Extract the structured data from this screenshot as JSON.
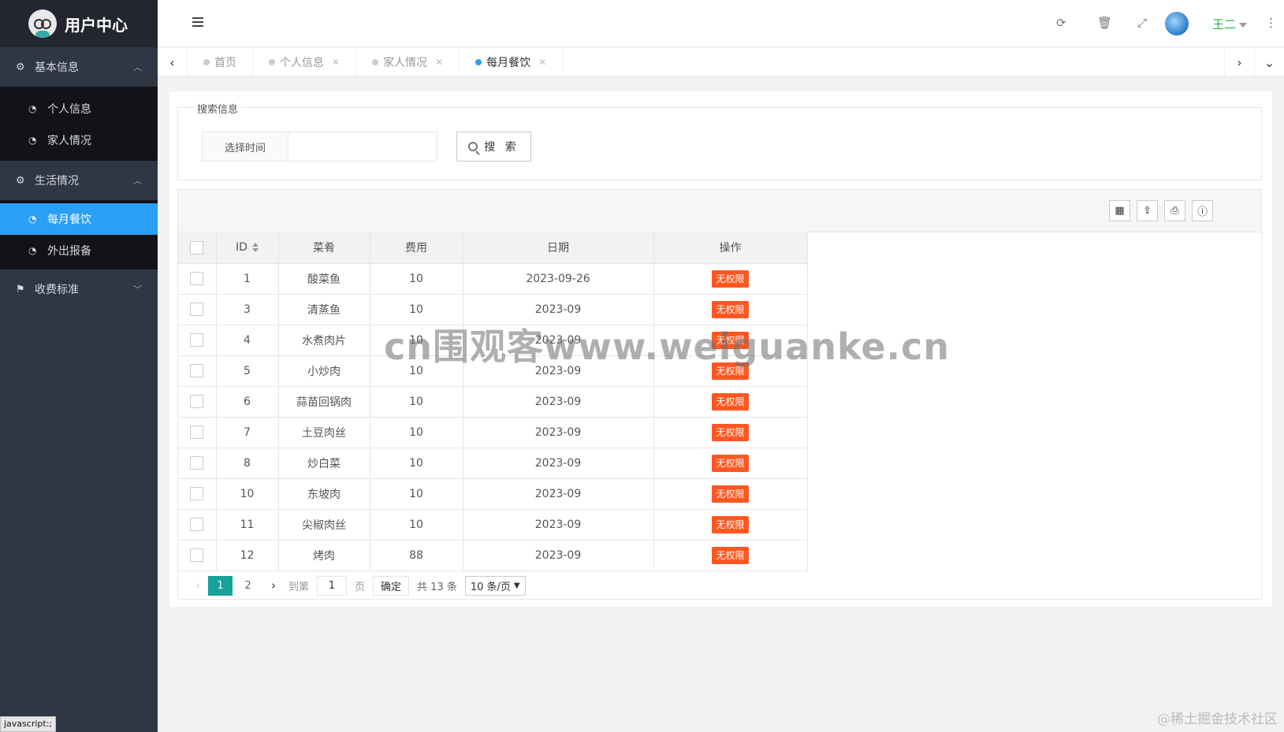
{
  "app": {
    "title": "用户中心"
  },
  "sidebar": {
    "groups": [
      {
        "label": "基本信息",
        "items": [
          {
            "label": "个人信息"
          },
          {
            "label": "家人情况"
          }
        ]
      },
      {
        "label": "生活情况",
        "items": [
          {
            "label": "每月餐饮"
          },
          {
            "label": "外出报备"
          }
        ]
      },
      {
        "label": "收费标准"
      }
    ],
    "active_item": "每月餐饮"
  },
  "header": {
    "user_name": "王二"
  },
  "tabs": [
    {
      "label": "首页",
      "closable": false
    },
    {
      "label": "个人信息",
      "closable": true
    },
    {
      "label": "家人情况",
      "closable": true
    },
    {
      "label": "每月餐饮",
      "closable": true,
      "active": true
    }
  ],
  "search": {
    "legend": "搜索信息",
    "time_label": "选择时间",
    "time_value": "",
    "button_label": "搜 索"
  },
  "table": {
    "columns": [
      "ID",
      "菜肴",
      "费用",
      "日期",
      "操作"
    ],
    "rows": [
      {
        "id": "1",
        "dish": "酸菜鱼",
        "cost": "10",
        "date": "2023-09-26",
        "action": "无权限"
      },
      {
        "id": "3",
        "dish": "清蒸鱼",
        "cost": "10",
        "date": "2023-09",
        "action": "无权限"
      },
      {
        "id": "4",
        "dish": "水煮肉片",
        "cost": "10",
        "date": "2023-09",
        "action": "无权限"
      },
      {
        "id": "5",
        "dish": "小炒肉",
        "cost": "10",
        "date": "2023-09",
        "action": "无权限"
      },
      {
        "id": "6",
        "dish": "蒜苗回锅肉",
        "cost": "10",
        "date": "2023-09",
        "action": "无权限"
      },
      {
        "id": "7",
        "dish": "土豆肉丝",
        "cost": "10",
        "date": "2023-09",
        "action": "无权限"
      },
      {
        "id": "8",
        "dish": "炒白菜",
        "cost": "10",
        "date": "2023-09",
        "action": "无权限"
      },
      {
        "id": "10",
        "dish": "东坡肉",
        "cost": "10",
        "date": "2023-09",
        "action": "无权限"
      },
      {
        "id": "11",
        "dish": "尖椒肉丝",
        "cost": "10",
        "date": "2023-09",
        "action": "无权限"
      },
      {
        "id": "12",
        "dish": "烤肉",
        "cost": "88",
        "date": "2023-09",
        "action": "无权限"
      }
    ]
  },
  "pager": {
    "pages": [
      "1",
      "2"
    ],
    "current": "1",
    "goto_label": "到第",
    "goto_value": "1",
    "page_unit": "页",
    "ok_label": "确定",
    "total": "共 13 条",
    "page_size": "10 条/页"
  },
  "status_tip": "javascript:;",
  "watermark": "cn围观客www.weiguanke.cn",
  "corner_watermark": "@稀土掘金技术社区"
}
